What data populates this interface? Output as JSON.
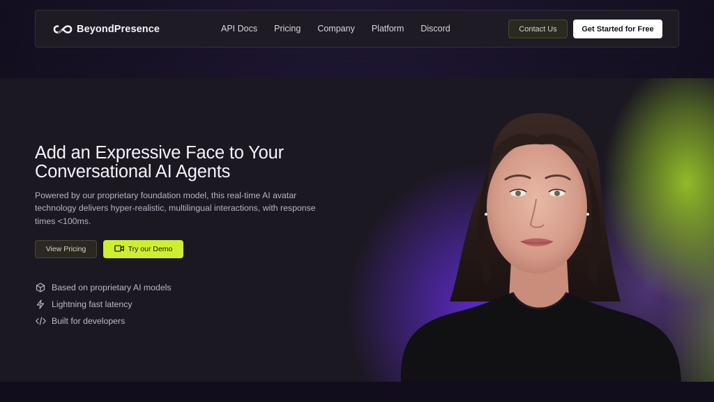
{
  "brand": {
    "name": "BeyondPresence",
    "icon": "infinity-logo-icon"
  },
  "nav": {
    "links": [
      "API Docs",
      "Pricing",
      "Company",
      "Platform",
      "Discord"
    ],
    "contact_label": "Contact Us",
    "cta_label": "Get Started for Free"
  },
  "hero": {
    "title": "Add an Expressive Face to Your Conversational AI Agents",
    "description": "Powered by our proprietary foundation model, this real-time AI avatar technology delivers hyper-realistic, multilingual interactions, with response times <100ms.",
    "pricing_button": "View Pricing",
    "demo_button": "Try our Demo",
    "demo_icon": "video-camera-icon",
    "features": [
      {
        "icon": "cube-icon",
        "label": "Based on proprietary AI models"
      },
      {
        "icon": "lightning-icon",
        "label": "Lightning fast latency"
      },
      {
        "icon": "code-icon",
        "label": "Built for developers"
      }
    ]
  },
  "colors": {
    "accent": "#cdef2f",
    "background": "#140f22",
    "hero_background": "#1c1822",
    "glow_purple": "#602ad2",
    "glow_green": "#98c428"
  }
}
